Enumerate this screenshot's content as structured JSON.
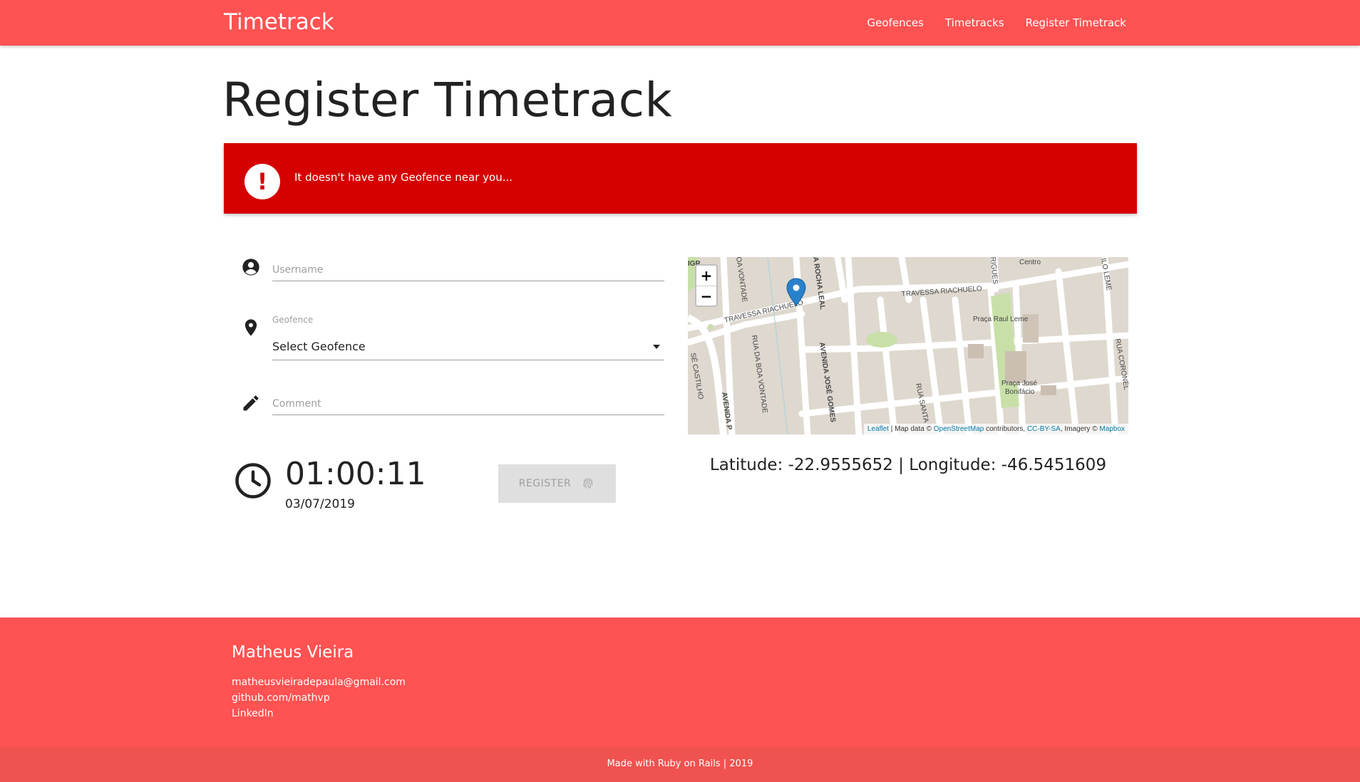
{
  "navbar": {
    "brand": "Timetrack",
    "links": [
      {
        "label": "Geofences"
      },
      {
        "label": "Timetracks"
      },
      {
        "label": "Register Timetrack"
      }
    ]
  },
  "page": {
    "title": "Register Timetrack"
  },
  "alert": {
    "icon": "exclamation-icon",
    "message": "It doesn't have any Geofence near you..."
  },
  "form": {
    "username": {
      "placeholder": "Username",
      "value": "",
      "icon": "account-circle-icon"
    },
    "geofence": {
      "label": "Geofence",
      "selected": "Select Geofence",
      "icon": "location-pin-icon"
    },
    "comment": {
      "placeholder": "Comment",
      "value": "",
      "icon": "pencil-icon"
    }
  },
  "clock": {
    "icon": "clock-icon",
    "time": "01:00:11",
    "date": "03/07/2019"
  },
  "register_button": {
    "label": "REGISTER",
    "icon": "fingerprint-icon"
  },
  "map": {
    "zoom_in": "+",
    "zoom_out": "−",
    "labels": [
      "Centro",
      "TRAVESSA RIACHUELO",
      "TRAVESSA RIACHUELO",
      "Praça Raul Leme",
      "Praça José",
      "Bonifácio",
      "AVENIDA JOSÉ GOMES",
      "A ROCHA LEAL",
      "RUA DA BOA VONTADE",
      "OA VONTADE",
      "AVENIDA P",
      "RUA SANTA",
      "RIGUES",
      "ILO LEME",
      "RUA CORONEL",
      "SÉ CASTILHO",
      "IGR"
    ],
    "attribution": {
      "leaflet": "Leaflet",
      "map_data": " | Map data © ",
      "osm": "OpenStreetMap",
      "contributors": " contributors, ",
      "license": "CC-BY-SA",
      "imagery": ", Imagery © ",
      "mapbox": "Mapbox"
    }
  },
  "location": {
    "text": "Latitude: -22.9555652 | Longitude: -46.5451609"
  },
  "footer": {
    "name": "Matheus Vieira",
    "links": [
      {
        "label": "matheusvieiradepaula@gmail.com"
      },
      {
        "label": "github.com/mathvp"
      },
      {
        "label": "LinkedIn"
      }
    ],
    "bottom": "Made with Ruby on Rails | 2019"
  },
  "colors": {
    "primary": "#ff5252",
    "alert": "#d50000",
    "footer_bottom": "#f0524f"
  }
}
